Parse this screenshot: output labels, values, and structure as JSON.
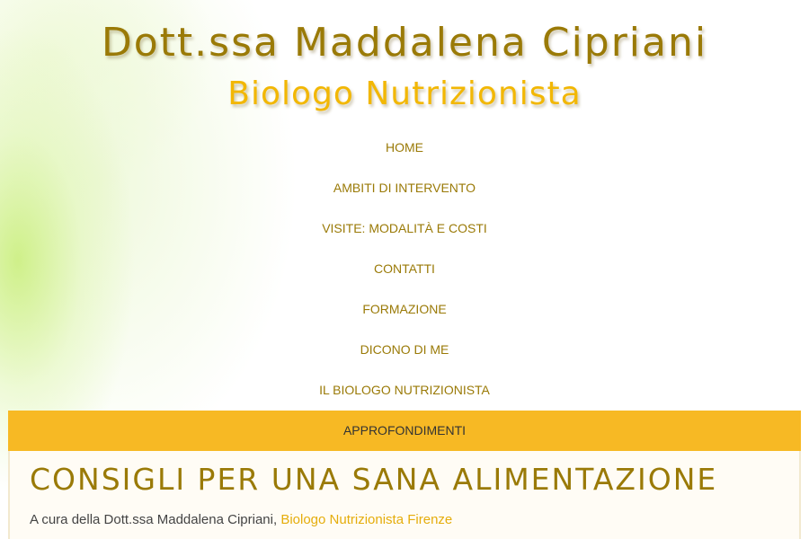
{
  "header": {
    "title": "Dott.ssa Maddalena Cipriani",
    "subtitle": "Biologo Nutrizionista"
  },
  "nav": {
    "items": [
      {
        "label": "HOME"
      },
      {
        "label": "AMBITI DI INTERVENTO"
      },
      {
        "label": "VISITE: MODALITÀ E COSTI"
      },
      {
        "label": "CONTATTI"
      },
      {
        "label": "FORMAZIONE"
      },
      {
        "label": "DICONO DI ME"
      },
      {
        "label": "IL BIOLOGO NUTRIZIONISTA"
      },
      {
        "label": "APPROFONDIMENTI"
      }
    ],
    "active": "APPROFONDIMENTI"
  },
  "article": {
    "title": "CONSIGLI PER UNA SANA ALIMENTAZIONE",
    "byline_prefix": "A cura della Dott.ssa Maddalena Cipriani, ",
    "byline_link": "Biologo Nutrizionista Firenze"
  },
  "colors": {
    "brand": "#9a7a07",
    "accent": "#f7b924",
    "link": "#e5ad0c"
  }
}
